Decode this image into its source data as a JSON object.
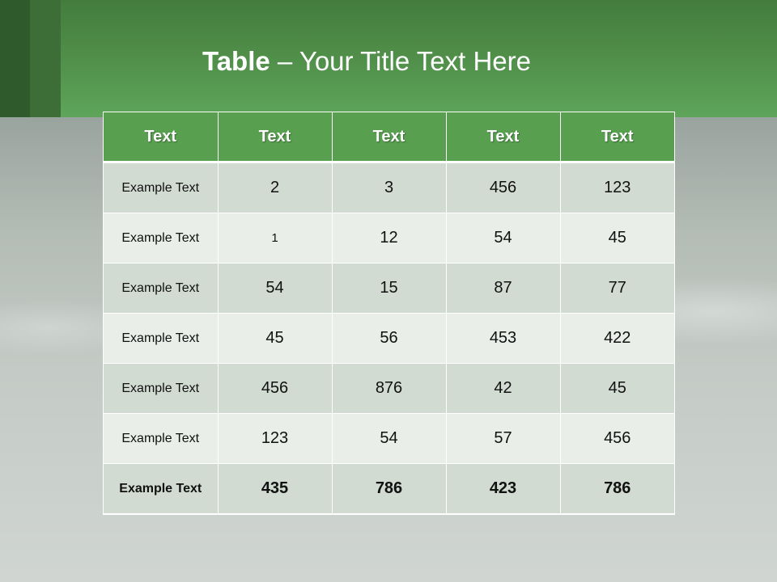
{
  "title": {
    "bold": "Table",
    "rest": " – Your Title Text Here"
  },
  "table": {
    "headers": [
      "Text",
      "Text",
      "Text",
      "Text",
      "Text"
    ],
    "rows": [
      [
        "Example Text",
        "2",
        "3",
        "456",
        "123"
      ],
      [
        "Example Text",
        "1",
        "12",
        "54",
        "45"
      ],
      [
        "Example Text",
        "54",
        "15",
        "87",
        "77"
      ],
      [
        "Example Text",
        "45",
        "56",
        "453",
        "422"
      ],
      [
        "Example Text",
        "456",
        "876",
        "42",
        "45"
      ],
      [
        "Example Text",
        "123",
        "54",
        "57",
        "456"
      ],
      [
        "Example Text",
        "435",
        "786",
        "423",
        "786"
      ]
    ]
  },
  "colors": {
    "header_green": "#58a050",
    "banner_green": "#4f8d48",
    "row_dark": "#d1dbd2",
    "row_light": "#e9eee9"
  }
}
